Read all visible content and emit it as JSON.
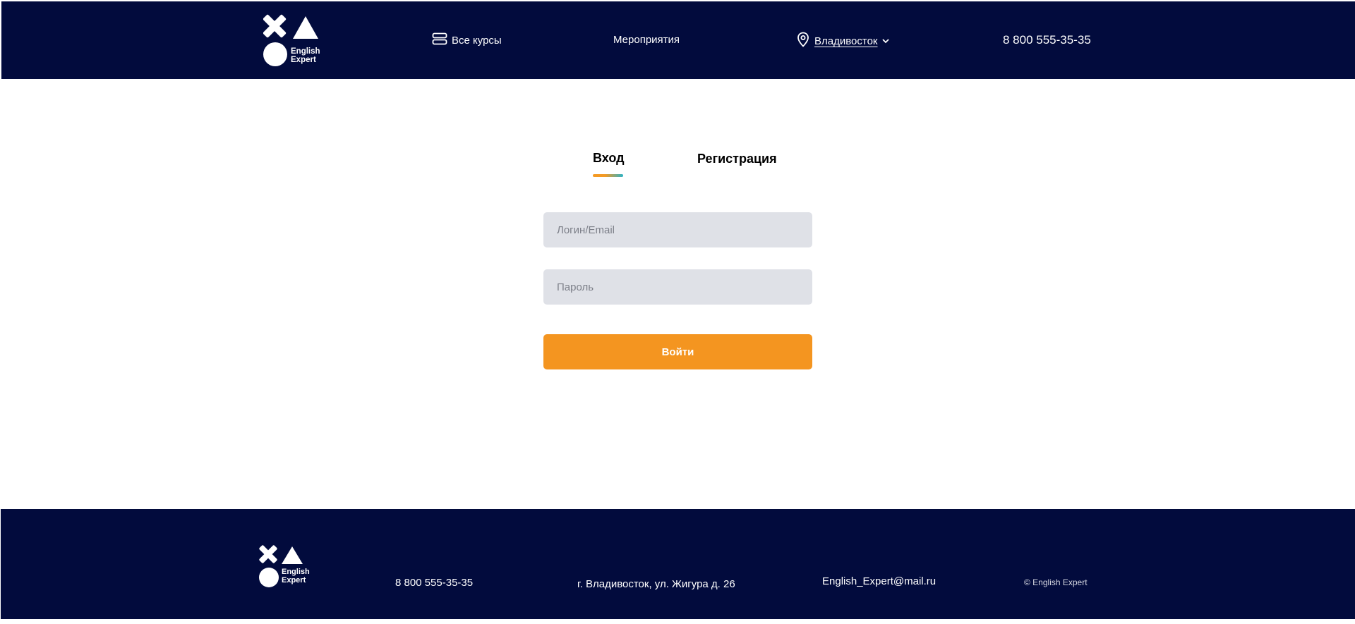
{
  "header": {
    "logo": {
      "line1": "English",
      "line2": "Expert"
    },
    "nav": {
      "courses_label": "Все курсы",
      "events_label": "Мероприятия",
      "city_label": "Владивосток"
    },
    "phone": "8 800 555-35-35"
  },
  "auth": {
    "tabs": {
      "login": "Вход",
      "register": "Регистрация"
    },
    "active_tab": "login",
    "login_placeholder": "Логин/Email",
    "password_placeholder": "Пароль",
    "submit_label": "Войти"
  },
  "footer": {
    "logo": {
      "line1": "English",
      "line2": "Expert"
    },
    "phone": "8 800 555-35-35",
    "address": "г. Владивосток, ул. Жигура д. 26",
    "email": "English_Expert@mail.ru",
    "copyright": "© English Expert"
  },
  "colors": {
    "navy": "#020b3d",
    "accent_orange": "#f49520",
    "accent_teal": "#2ab3c7",
    "field_bg": "#dfe1e7"
  },
  "icons": {
    "courses": "list-icon",
    "city": "location-pin-icon",
    "city_dropdown": "chevron-down-icon"
  }
}
